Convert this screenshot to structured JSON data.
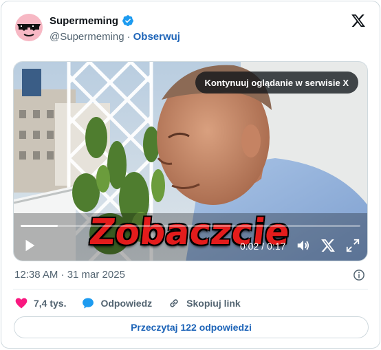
{
  "author": {
    "display_name": "Supermeming",
    "handle": "@Supermeming",
    "separator": "·",
    "follow_label": "Obserwuj"
  },
  "video": {
    "continue_label": "Kontynuuj oglądanie w serwisie X",
    "caption": "Zobaczcie",
    "current_time": "0:02",
    "time_separator": "/",
    "duration": "0:17",
    "progress": 0.11
  },
  "meta": {
    "timestamp": "12:38 AM · 31 mar 2025"
  },
  "actions": {
    "likes": "7,4 tys.",
    "reply_label": "Odpowiedz",
    "copy_link_label": "Skopiuj link"
  },
  "replies_button": "Przeczytaj 122 odpowiedzi",
  "colors": {
    "accent": "#1d64b8",
    "like": "#f91880",
    "verified": "#1d9bf0",
    "caption_red": "#e31c1c"
  },
  "icons": [
    "avatar-sunglasses",
    "verified-badge-icon",
    "x-logo-icon",
    "play-icon",
    "volume-icon",
    "x-small-icon",
    "fullscreen-icon",
    "info-icon",
    "heart-icon",
    "reply-bubble-icon",
    "link-icon"
  ]
}
